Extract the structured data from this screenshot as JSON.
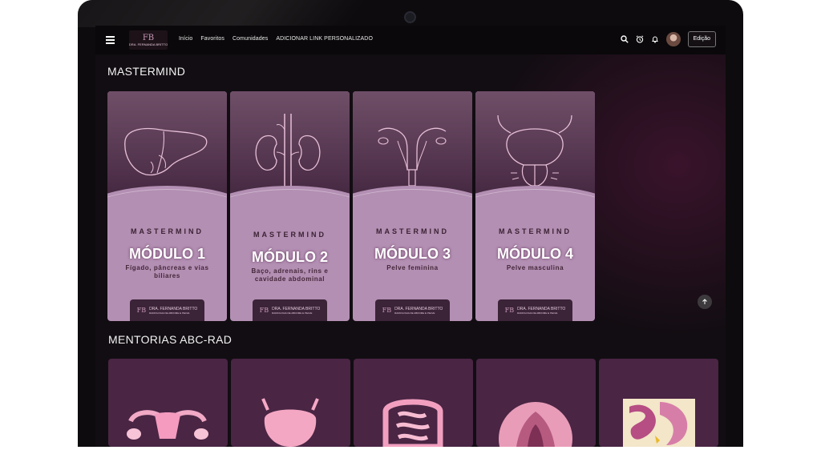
{
  "nav": {
    "logo_mark": "FB",
    "logo_text": "DRA. FERNANDA BRITTO",
    "links": [
      "Início",
      "Favoritos",
      "Comunidades",
      "ADICIONAR LINK PERSONALIZADO"
    ],
    "edit_label": "Edição"
  },
  "sections": {
    "mastermind_title": "MASTERMIND",
    "mentorias_title": "MENTORIAS ABC-RAD"
  },
  "cards": [
    {
      "label": "MASTERMIND",
      "module": "MÓDULO 1",
      "desc": "Fígado, pâncreas e vias biliares",
      "organ": "liver"
    },
    {
      "label": "MASTERMIND",
      "module": "MÓDULO 2",
      "desc": "Baço, adrenais, rins e cavidade abdominal",
      "organ": "kidneys"
    },
    {
      "label": "MASTERMIND",
      "module": "MÓDULO 3",
      "desc": "Pelve feminina",
      "organ": "uterus"
    },
    {
      "label": "MASTERMIND",
      "module": "MÓDULO 4",
      "desc": "Pelve masculina",
      "organ": "bladder"
    }
  ],
  "card_brand": {
    "mark": "FB",
    "name": "DRA. FERNANDA BRITTO",
    "sub": "RADIOLOGIA DE ABDOME E PELVE"
  },
  "mentorias": [
    "uterus-icon",
    "bladder-icon",
    "intestine-icon",
    "rectum-icon",
    "pelvis-section-icon"
  ],
  "colors": {
    "accent": "#b38fb3",
    "card_dark": "#4a2544",
    "background": "#120d12"
  }
}
